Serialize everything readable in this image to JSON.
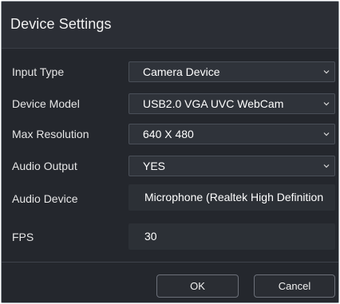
{
  "dialog": {
    "title": "Device Settings"
  },
  "fields": {
    "input_type": {
      "label": "Input Type",
      "value": "Camera Device"
    },
    "device_model": {
      "label": "Device Model",
      "value": "USB2.0 VGA UVC WebCam"
    },
    "max_resolution": {
      "label": "Max Resolution",
      "value": "640 X 480"
    },
    "audio_output": {
      "label": "Audio Output",
      "value": "YES"
    },
    "audio_device": {
      "label": "Audio Device",
      "value": "Microphone (Realtek High Definition"
    },
    "fps": {
      "label": "FPS",
      "value": "30"
    }
  },
  "buttons": {
    "ok": "OK",
    "cancel": "Cancel"
  },
  "icons": {
    "dropdown": "chevron-down-icon"
  },
  "colors": {
    "dialog_bg": "#24272d",
    "titlebar_bg": "#2b2e35",
    "field_bg": "#2f333a",
    "text": "#f1f1f1"
  }
}
